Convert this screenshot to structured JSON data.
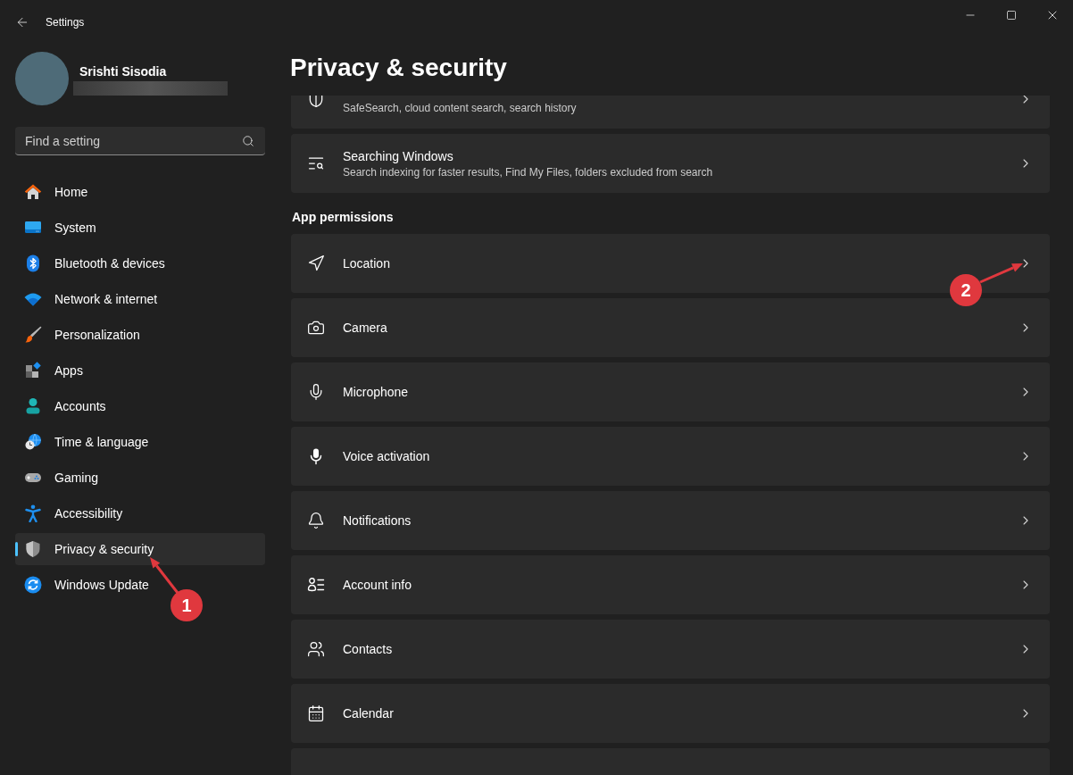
{
  "window": {
    "title": "Settings"
  },
  "profile": {
    "name": "Srishti Sisodia"
  },
  "search": {
    "placeholder": "Find a setting"
  },
  "sidebar": {
    "items": [
      {
        "label": "Home",
        "selected": false
      },
      {
        "label": "System",
        "selected": false
      },
      {
        "label": "Bluetooth & devices",
        "selected": false
      },
      {
        "label": "Network & internet",
        "selected": false
      },
      {
        "label": "Personalization",
        "selected": false
      },
      {
        "label": "Apps",
        "selected": false
      },
      {
        "label": "Accounts",
        "selected": false
      },
      {
        "label": "Time & language",
        "selected": false
      },
      {
        "label": "Gaming",
        "selected": false
      },
      {
        "label": "Accessibility",
        "selected": false
      },
      {
        "label": "Privacy & security",
        "selected": true
      },
      {
        "label": "Windows Update",
        "selected": false
      }
    ]
  },
  "page": {
    "title": "Privacy & security"
  },
  "security_cards": [
    {
      "kind": "link",
      "subtitle": "SafeSearch, cloud content search, search history"
    },
    {
      "kind": "link",
      "title": "Searching Windows",
      "subtitle": "Search indexing for faster results, Find My Files, folders excluded from search"
    }
  ],
  "app_permissions": {
    "heading": "App permissions",
    "items": [
      {
        "kind": "link",
        "title": "Location"
      },
      {
        "kind": "link",
        "title": "Camera"
      },
      {
        "kind": "link",
        "title": "Microphone"
      },
      {
        "kind": "link",
        "title": "Voice activation"
      },
      {
        "kind": "link",
        "title": "Notifications"
      },
      {
        "kind": "link",
        "title": "Account info"
      },
      {
        "kind": "link",
        "title": "Contacts"
      },
      {
        "kind": "link",
        "title": "Calendar"
      },
      {
        "kind": "link"
      }
    ]
  },
  "annotations": [
    {
      "number": "1"
    },
    {
      "number": "2"
    }
  ]
}
